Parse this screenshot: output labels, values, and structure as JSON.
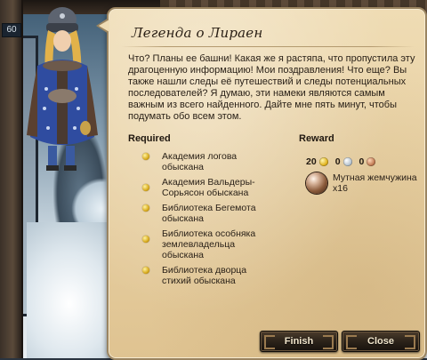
{
  "hud": {
    "level_badge": "60"
  },
  "dialog": {
    "title": "Легенда о Лираен",
    "body": "Что? Планы ее башни! Какая же я растяпа, что пропустила эту драгоценную информацию! Мои поздравления! Что еще? Вы также нашли следы её путешествий и следы потенциальных последователей? Я думаю, эти намеки являются самым важным из всего найденного. Дайте мне пять минут, чтобы подумать обо всем этом.",
    "required_label": "Required",
    "reward_label": "Reward",
    "requirements": [
      {
        "text": "Академия логова обыскана"
      },
      {
        "text": "Академия Вальдеры-Сорьясон обыскана"
      },
      {
        "text": "Библиотека Бегемота обыскана"
      },
      {
        "text": "Библиотека особняка землевладельца обыскана"
      },
      {
        "text": "Библиотека дворца стихий обыскана"
      }
    ],
    "rewards": {
      "gold": "20",
      "silver": "0",
      "bronze": "0",
      "item_name": "Мутная жемчужина",
      "item_qty": "x16"
    },
    "buttons": {
      "finish": "Finish",
      "close": "Close"
    }
  },
  "colors": {
    "parchment": "#e9d3a6",
    "button_dark": "#2e251b",
    "bullet_gold": "#d7a91b"
  }
}
